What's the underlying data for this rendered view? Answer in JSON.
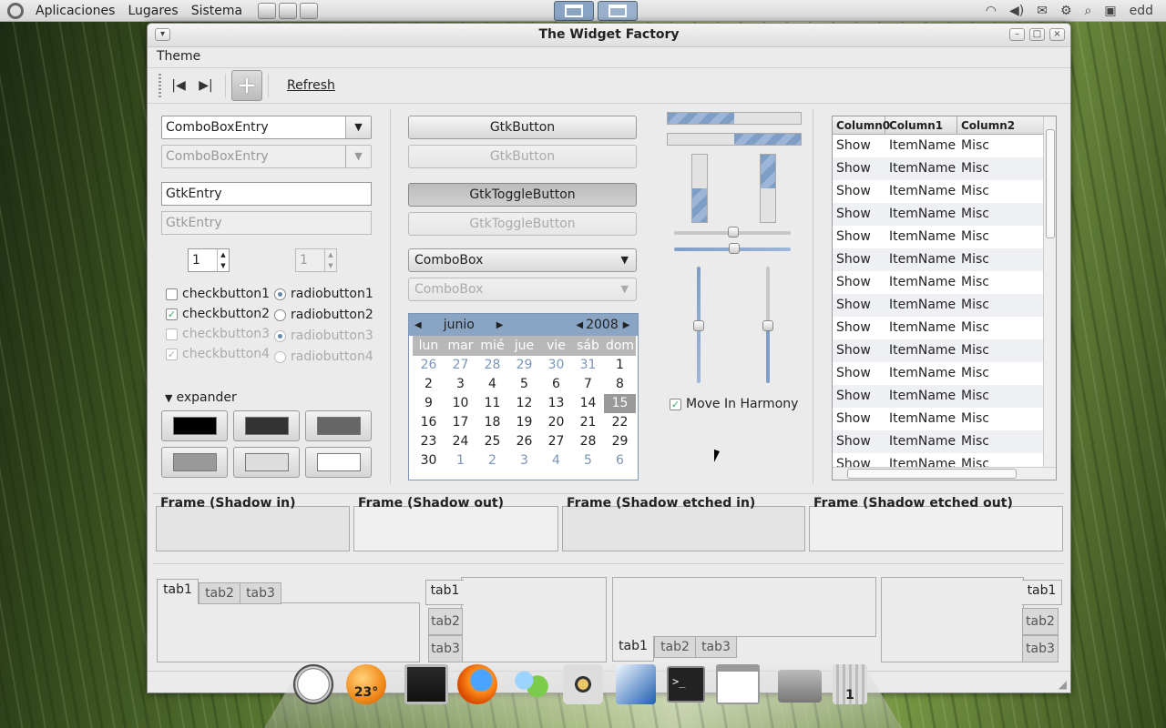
{
  "panel": {
    "menus": [
      "Aplicaciones",
      "Lugares",
      "Sistema"
    ],
    "user": "edd"
  },
  "window": {
    "title": "The Widget Factory",
    "menu": [
      "Theme"
    ],
    "refresh": "Refresh"
  },
  "col1": {
    "combo_entry": "ComboBoxEntry",
    "combo_entry_dis": "ComboBoxEntry",
    "entry": "GtkEntry",
    "entry_dis": "GtkEntry",
    "spin": "1",
    "spin_dis": "1",
    "checks": [
      {
        "label": "checkbutton1",
        "checked": false
      },
      {
        "label": "checkbutton2",
        "checked": true
      },
      {
        "label": "checkbutton3",
        "checked": false
      },
      {
        "label": "checkbutton4",
        "checked": true
      }
    ],
    "radios": [
      {
        "label": "radiobutton1",
        "on": true
      },
      {
        "label": "radiobutton2",
        "on": false
      },
      {
        "label": "radiobutton3",
        "on": true
      },
      {
        "label": "radiobutton4",
        "on": false
      }
    ],
    "expander": "expander",
    "swatches": [
      "#000000",
      "#333333",
      "#666666",
      "#999999",
      "#dddddd",
      "#ffffff"
    ]
  },
  "col2": {
    "button": "GtkButton",
    "button_dis": "GtkButton",
    "toggle": "GtkToggleButton",
    "toggle_dis": "GtkToggleButton",
    "combo": "ComboBox",
    "combo_dis": "ComboBox"
  },
  "calendar": {
    "month": "junio",
    "year": "2008",
    "weekdays": [
      "lun",
      "mar",
      "mié",
      "jue",
      "vie",
      "sáb",
      "dom"
    ],
    "days": [
      "26",
      "27",
      "28",
      "29",
      "30",
      "31",
      "1",
      "2",
      "3",
      "4",
      "5",
      "6",
      "7",
      "8",
      "9",
      "10",
      "11",
      "12",
      "13",
      "14",
      "15",
      "16",
      "17",
      "18",
      "19",
      "20",
      "21",
      "22",
      "23",
      "24",
      "25",
      "26",
      "27",
      "28",
      "29",
      "30",
      "1",
      "2",
      "3",
      "4",
      "5",
      "6"
    ],
    "selected": "15"
  },
  "col3": {
    "progress1": 0.5,
    "progress2": 0.5,
    "move_in_harmony": "Move In Harmony"
  },
  "tree": {
    "columns": [
      "Column0",
      "Column1",
      "Column2"
    ],
    "rows": [
      [
        "Show",
        "ItemName",
        "Misc"
      ],
      [
        "Show",
        "ItemName",
        "Misc"
      ],
      [
        "Show",
        "ItemName",
        "Misc"
      ],
      [
        "Show",
        "ItemName",
        "Misc"
      ],
      [
        "Show",
        "ItemName",
        "Misc"
      ],
      [
        "Show",
        "ItemName",
        "Misc"
      ],
      [
        "Show",
        "ItemName",
        "Misc"
      ],
      [
        "Show",
        "ItemName",
        "Misc"
      ],
      [
        "Show",
        "ItemName",
        "Misc"
      ],
      [
        "Show",
        "ItemName",
        "Misc"
      ],
      [
        "Show",
        "ItemName",
        "Misc"
      ],
      [
        "Show",
        "ItemName",
        "Misc"
      ],
      [
        "Show",
        "ItemName",
        "Misc"
      ],
      [
        "Show",
        "ItemName",
        "Misc"
      ],
      [
        "Show",
        "ItemName",
        "Misc"
      ]
    ]
  },
  "frames": [
    "Frame (Shadow in)",
    "Frame (Shadow out)",
    "Frame (Shadow etched in)",
    "Frame (Shadow etched out)"
  ],
  "tabs": [
    "tab1",
    "tab2",
    "tab3"
  ],
  "dock": {
    "weather": "23°",
    "trash": "1"
  }
}
